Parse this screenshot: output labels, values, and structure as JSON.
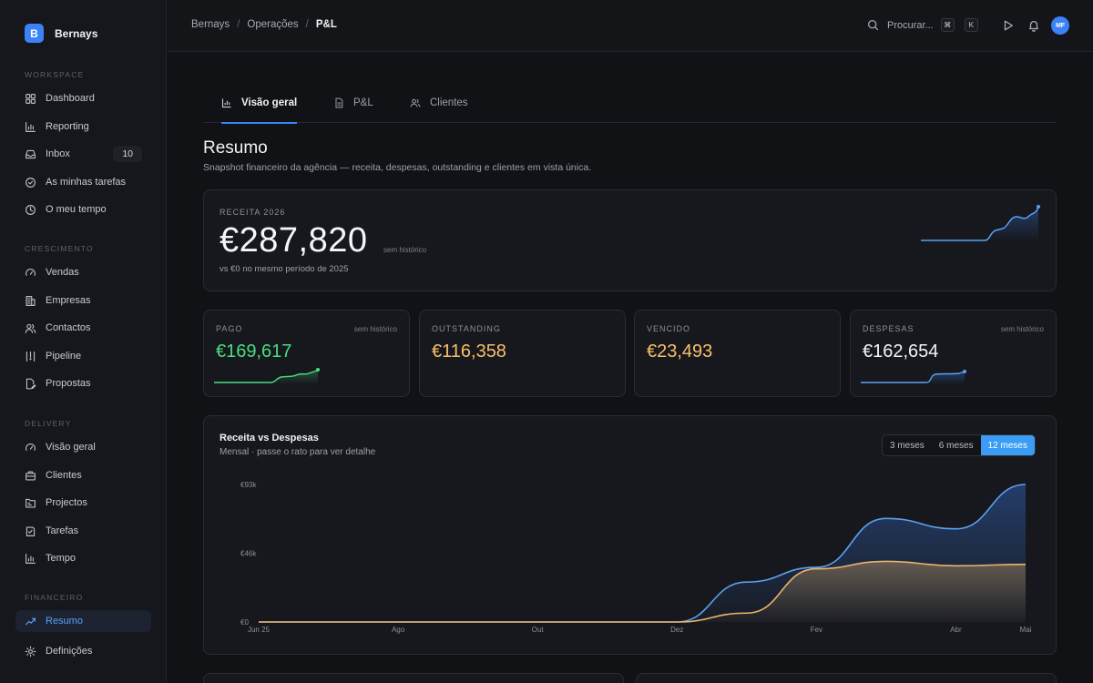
{
  "brand": {
    "logo_letter": "B",
    "name": "Bernays"
  },
  "sidebar": {
    "sections": [
      {
        "label": "WORKSPACE",
        "items": [
          {
            "label": "Dashboard",
            "icon": "dashboard-icon"
          },
          {
            "label": "Reporting",
            "icon": "bar-chart-icon"
          },
          {
            "label": "Inbox",
            "icon": "inbox-icon",
            "badge": "10"
          },
          {
            "label": "As minhas tarefas",
            "icon": "check-circle-icon"
          },
          {
            "label": "O meu tempo",
            "icon": "clock-icon"
          }
        ]
      },
      {
        "label": "CRESCIMENTO",
        "items": [
          {
            "label": "Vendas",
            "icon": "gauge-icon"
          },
          {
            "label": "Empresas",
            "icon": "building-icon"
          },
          {
            "label": "Contactos",
            "icon": "users-icon"
          },
          {
            "label": "Pipeline",
            "icon": "pipeline-icon"
          },
          {
            "label": "Propostas",
            "icon": "document-edit-icon"
          }
        ]
      },
      {
        "label": "DELIVERY",
        "items": [
          {
            "label": "Visão geral",
            "icon": "gauge-icon"
          },
          {
            "label": "Clientes",
            "icon": "briefcase-icon"
          },
          {
            "label": "Projectos",
            "icon": "folder-icon"
          },
          {
            "label": "Tarefas",
            "icon": "checklist-icon"
          },
          {
            "label": "Tempo",
            "icon": "bar-chart-icon"
          }
        ]
      },
      {
        "label": "FINANCEIRO",
        "items": [
          {
            "label": "Resumo",
            "icon": "trend-icon",
            "active": true
          }
        ]
      }
    ],
    "footer_item": {
      "label": "Definições",
      "icon": "gear-icon"
    }
  },
  "topbar": {
    "breadcrumb": [
      "Bernays",
      "Operações",
      "P&L"
    ],
    "search_label": "Procurar...",
    "shortcut_keys": [
      "⌘",
      "K"
    ],
    "avatar_initials": "MF"
  },
  "tabs": [
    {
      "label": "Visão geral",
      "icon": "bar-chart-icon",
      "active": true
    },
    {
      "label": "P&L",
      "icon": "document-icon",
      "active": false
    },
    {
      "label": "Clientes",
      "icon": "users-icon",
      "active": false
    }
  ],
  "page": {
    "title": "Resumo",
    "subtitle": "Snapshot financeiro da agência — receita, despesas, outstanding e clientes em vista única."
  },
  "revenue_card": {
    "label": "RECEITA 2026",
    "value": "€287,820",
    "note": "sem histórico",
    "comparison": "vs €0 no mesmo período de 2025"
  },
  "kpis": [
    {
      "label": "PAGO",
      "value": "€169,617",
      "note": "sem histórico",
      "color": "#4ade80",
      "sparkline": true
    },
    {
      "label": "OUTSTANDING",
      "value": "€116,358",
      "note": "",
      "color": "#fbbf6a",
      "sparkline": false
    },
    {
      "label": "VENCIDO",
      "value": "€23,493",
      "note": "",
      "color": "#fbbf6a",
      "sparkline": false
    },
    {
      "label": "DESPESAS",
      "value": "€162,654",
      "note": "sem histórico",
      "color": "#f3f4f6",
      "sparkline": true
    }
  ],
  "colors": {
    "accent": "#3b82f6",
    "revenue_line": "#5aa2f0",
    "expenses_line": "#e8b46a",
    "paid_line": "#4ade80"
  },
  "main_chart": {
    "title": "Receita vs Despesas",
    "subtitle": "Mensal · passe o rato para ver detalhe",
    "ranges": [
      {
        "label": "3 meses",
        "active": false
      },
      {
        "label": "6 meses",
        "active": false
      },
      {
        "label": "12 meses",
        "active": true
      }
    ]
  },
  "chart_data": {
    "type": "area",
    "title": "Receita vs Despesas",
    "x_tick_labels": [
      "Jun 25",
      "Ago",
      "Out",
      "Dez",
      "Fev",
      "Abr",
      "Mai"
    ],
    "y_tick_labels": [
      "€0",
      "€46k",
      "€93k"
    ],
    "ylim": [
      0,
      93000
    ],
    "x": [
      "Jun 25",
      "Jul",
      "Ago",
      "Set",
      "Out",
      "Nov",
      "Dez",
      "Jan",
      "Fev",
      "Mar",
      "Abr",
      "Mai"
    ],
    "series": [
      {
        "name": "",
        "color": "#5aa2f0",
        "values": [
          0,
          0,
          0,
          0,
          0,
          0,
          0,
          27000,
          37000,
          70000,
          63000,
          93000
        ]
      },
      {
        "name": "",
        "color": "#e8b46a",
        "values": [
          0,
          0,
          0,
          0,
          0,
          0,
          0,
          6000,
          36000,
          41000,
          38000,
          39000
        ]
      }
    ],
    "grid": false
  }
}
